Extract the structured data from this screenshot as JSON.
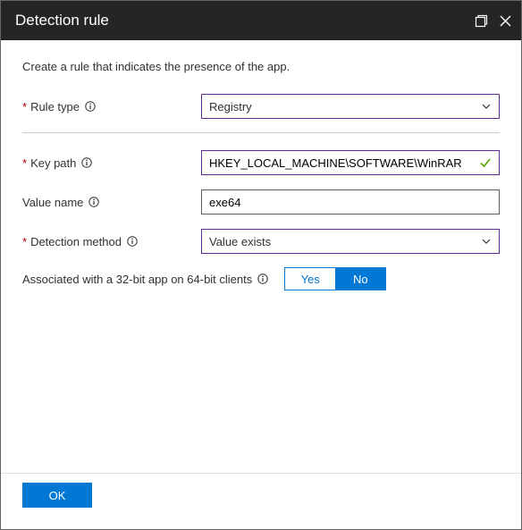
{
  "header": {
    "title": "Detection rule"
  },
  "content": {
    "intro": "Create a rule that indicates the presence of the app.",
    "labels": {
      "rule_type": "Rule type",
      "key_path": "Key path",
      "value_name": "Value name",
      "detection_method": "Detection method",
      "associated": "Associated with a 32-bit app on 64-bit clients"
    },
    "values": {
      "rule_type": "Registry",
      "key_path": "HKEY_LOCAL_MACHINE\\SOFTWARE\\WinRAR",
      "value_name": "exe64",
      "detection_method": "Value exists"
    },
    "toggle": {
      "yes": "Yes",
      "no": "No",
      "selected": "No"
    }
  },
  "footer": {
    "ok": "OK"
  }
}
